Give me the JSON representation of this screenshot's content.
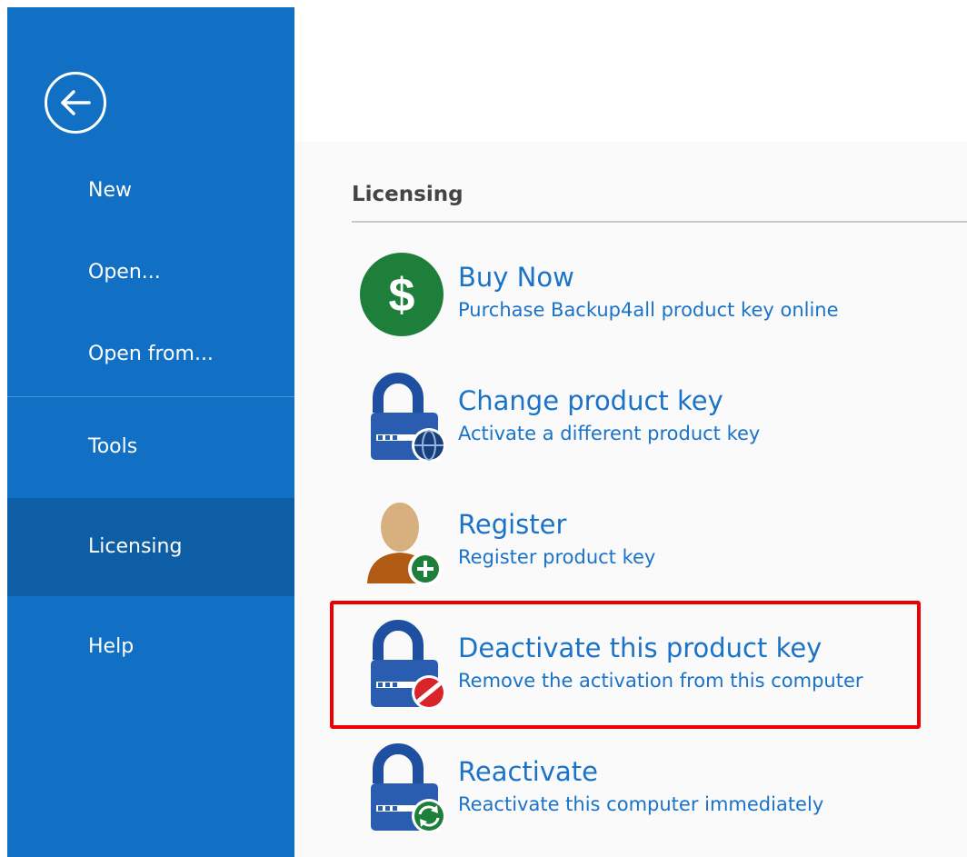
{
  "sidebar": {
    "items": [
      {
        "label": "New"
      },
      {
        "label": "Open..."
      },
      {
        "label": "Open from..."
      },
      {
        "label": "Tools"
      },
      {
        "label": "Licensing"
      },
      {
        "label": "Help"
      }
    ],
    "active_item": "Licensing",
    "background_color": "#1170c4",
    "active_background_color": "#0e5ea6"
  },
  "main": {
    "section_title": "Licensing",
    "options": [
      {
        "title": "Buy Now",
        "description": "Purchase Backup4all product key online",
        "icon": "dollar-icon"
      },
      {
        "title": "Change product key",
        "description": "Activate a different product key",
        "icon": "lock-globe-icon"
      },
      {
        "title": "Register",
        "description": "Register product key",
        "icon": "user-add-icon"
      },
      {
        "title": "Deactivate this product key",
        "description": "Remove the activation from this computer",
        "icon": "lock-deny-icon",
        "highlighted": true
      },
      {
        "title": "Reactivate",
        "description": "Reactivate this computer immediately",
        "icon": "lock-refresh-icon"
      }
    ],
    "link_color": "#1a73c9",
    "highlight_color": "#ee0000"
  }
}
